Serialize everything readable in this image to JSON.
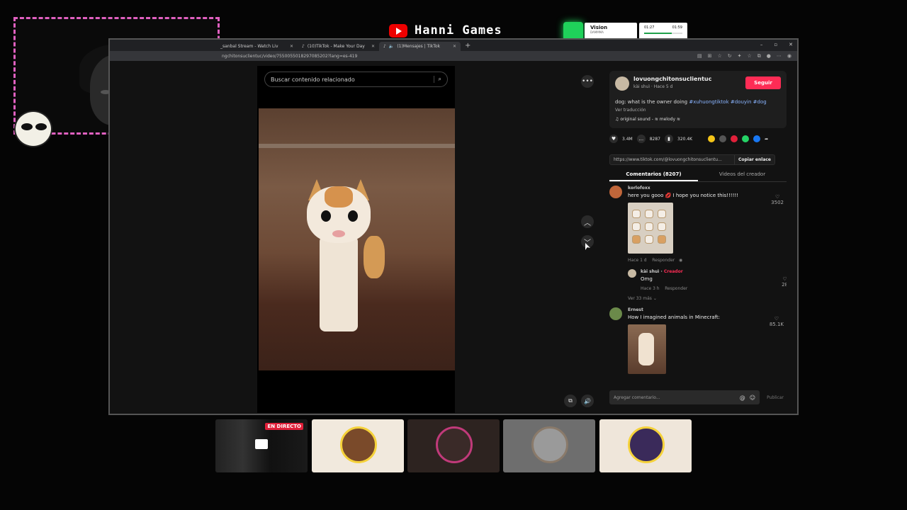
{
  "stream": {
    "channel_name": "Hanni Games",
    "widget": {
      "title": "Vision",
      "subtitle": "DAMMMA"
    },
    "player": {
      "elapsed": "01:27",
      "total": "01:59",
      "progress": 0.73
    },
    "live_badge": "EN DIRECTO"
  },
  "browser": {
    "tabs": [
      {
        "label": "_sanbal Stream - Watch Liv",
        "active": false
      },
      {
        "label": "(10)TikTok - Make Your Day",
        "active": false
      },
      {
        "label": "(1)Mensajes | TikTok",
        "active": true
      }
    ],
    "new_tab": "+",
    "url": "ngchitonsuclientuc/video/7550055018297085202?lang=es-419",
    "window_controls": [
      "–",
      "▫",
      "✕"
    ]
  },
  "tiktok": {
    "search_placeholder": "Buscar contenido relacionado",
    "author": {
      "username": "lovuongchitonsuclientuc",
      "subtitle": "kài shuì · Hace 5 d"
    },
    "follow_label": "Seguir",
    "description": "dog: what is the owner doing",
    "hashtags": "#xuhuongtiktok #douyin #dog",
    "translate_label": "Ver traducción",
    "sound": "original sound - ≋ melody ≋",
    "stats": {
      "likes": "3.4M",
      "comments": "8287",
      "saves": "320.4K"
    },
    "share_colors": [
      "#f5c518",
      "#555555",
      "#e0203a",
      "#25d366",
      "#1877f2"
    ],
    "link": "https://www.tiktok.com/@lovuongchitonsuclientu...",
    "copy_link": "Copiar enlace",
    "tabs": [
      {
        "label": "Comentarios (8207)",
        "active": true
      },
      {
        "label": "Videos del creador",
        "active": false
      }
    ],
    "comments": [
      {
        "user": "korlofoxx",
        "text": "here you gooo 💋 I hope you notice this!!!!!!",
        "meta": "Hace 1 d",
        "reply_label": "Responder",
        "likes": "3502"
      },
      {
        "user": "Ernest",
        "text": "How I imagined animals in Minecraft:",
        "likes": "85.1K"
      }
    ],
    "reply": {
      "user": "kài shuì",
      "role": "Creador",
      "text": "Omg",
      "meta": "Hace 3 h",
      "reply_label": "Responder",
      "likes": "28",
      "more": "Ver 33 más"
    },
    "composer_placeholder": "Agregar comentario...",
    "publish_label": "Publicar"
  }
}
